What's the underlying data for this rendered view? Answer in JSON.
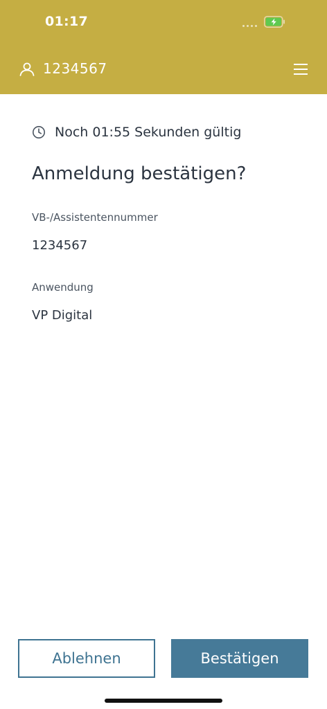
{
  "status_bar": {
    "time": "01:17",
    "battery_color": "#5fc950"
  },
  "header": {
    "user_id": "1234567",
    "background": "#c5ae43"
  },
  "content": {
    "timer_text": "Noch 01:55 Sekunden gültig",
    "title": "Anmeldung bestätigen?",
    "fields": [
      {
        "label": "VB-/Assistentennummer",
        "value": "1234567"
      },
      {
        "label": "Anwendung",
        "value": "VP Digital"
      }
    ]
  },
  "actions": {
    "reject_label": "Ablehnen",
    "confirm_label": "Bestätigen",
    "primary_color": "#467a98"
  }
}
